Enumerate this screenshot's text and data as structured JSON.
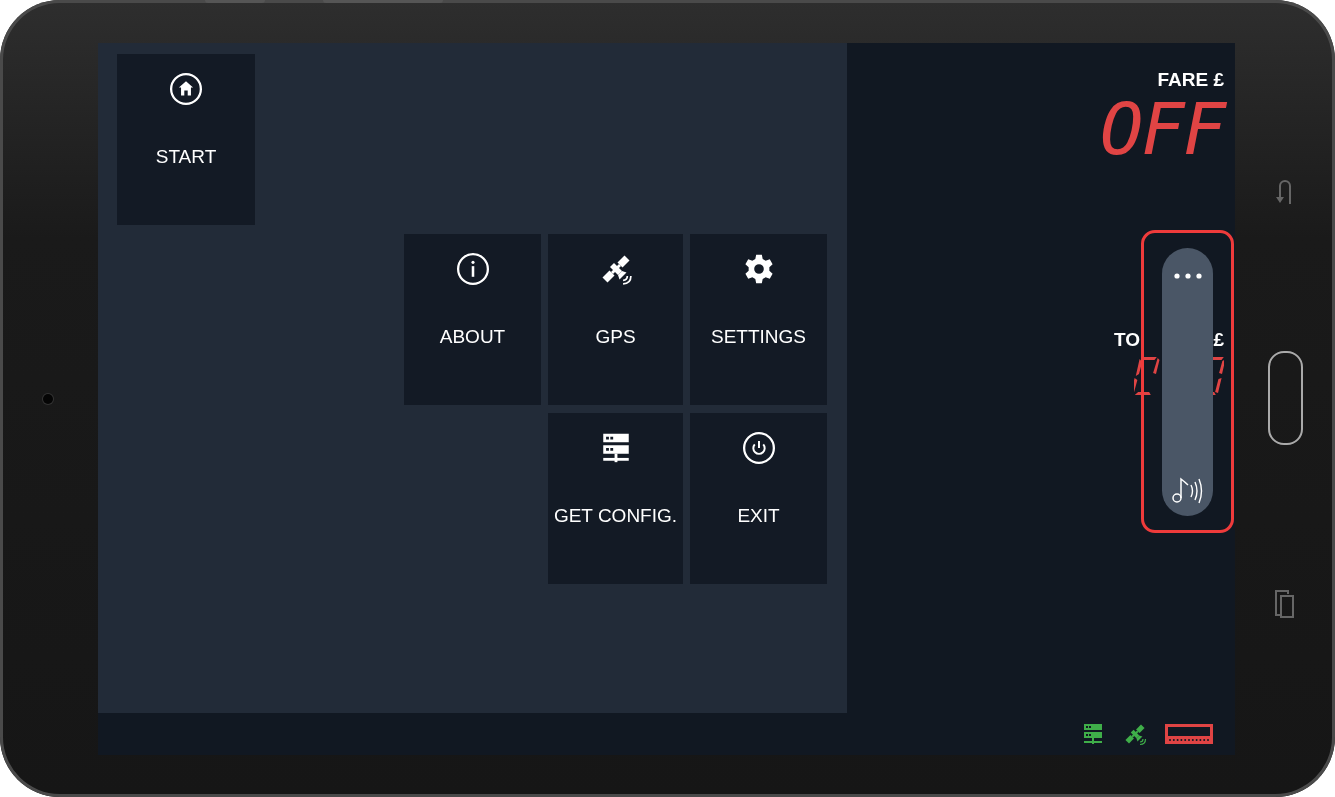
{
  "menu": {
    "tiles": [
      {
        "label": "START"
      },
      {
        "label": "ABOUT"
      },
      {
        "label": "GPS"
      },
      {
        "label": "SETTINGS"
      },
      {
        "label": "GET CONFIG."
      },
      {
        "label": "EXIT"
      }
    ]
  },
  "fare": {
    "label": "FARE £",
    "value": "OFF"
  },
  "total": {
    "label_start": "TO",
    "label_end": "£"
  },
  "volume_panel": {
    "outlined": true
  },
  "status_icons": [
    {
      "color": "#3fae49"
    },
    {
      "color": "#3fae49"
    },
    {
      "color": "#e04444"
    }
  ]
}
